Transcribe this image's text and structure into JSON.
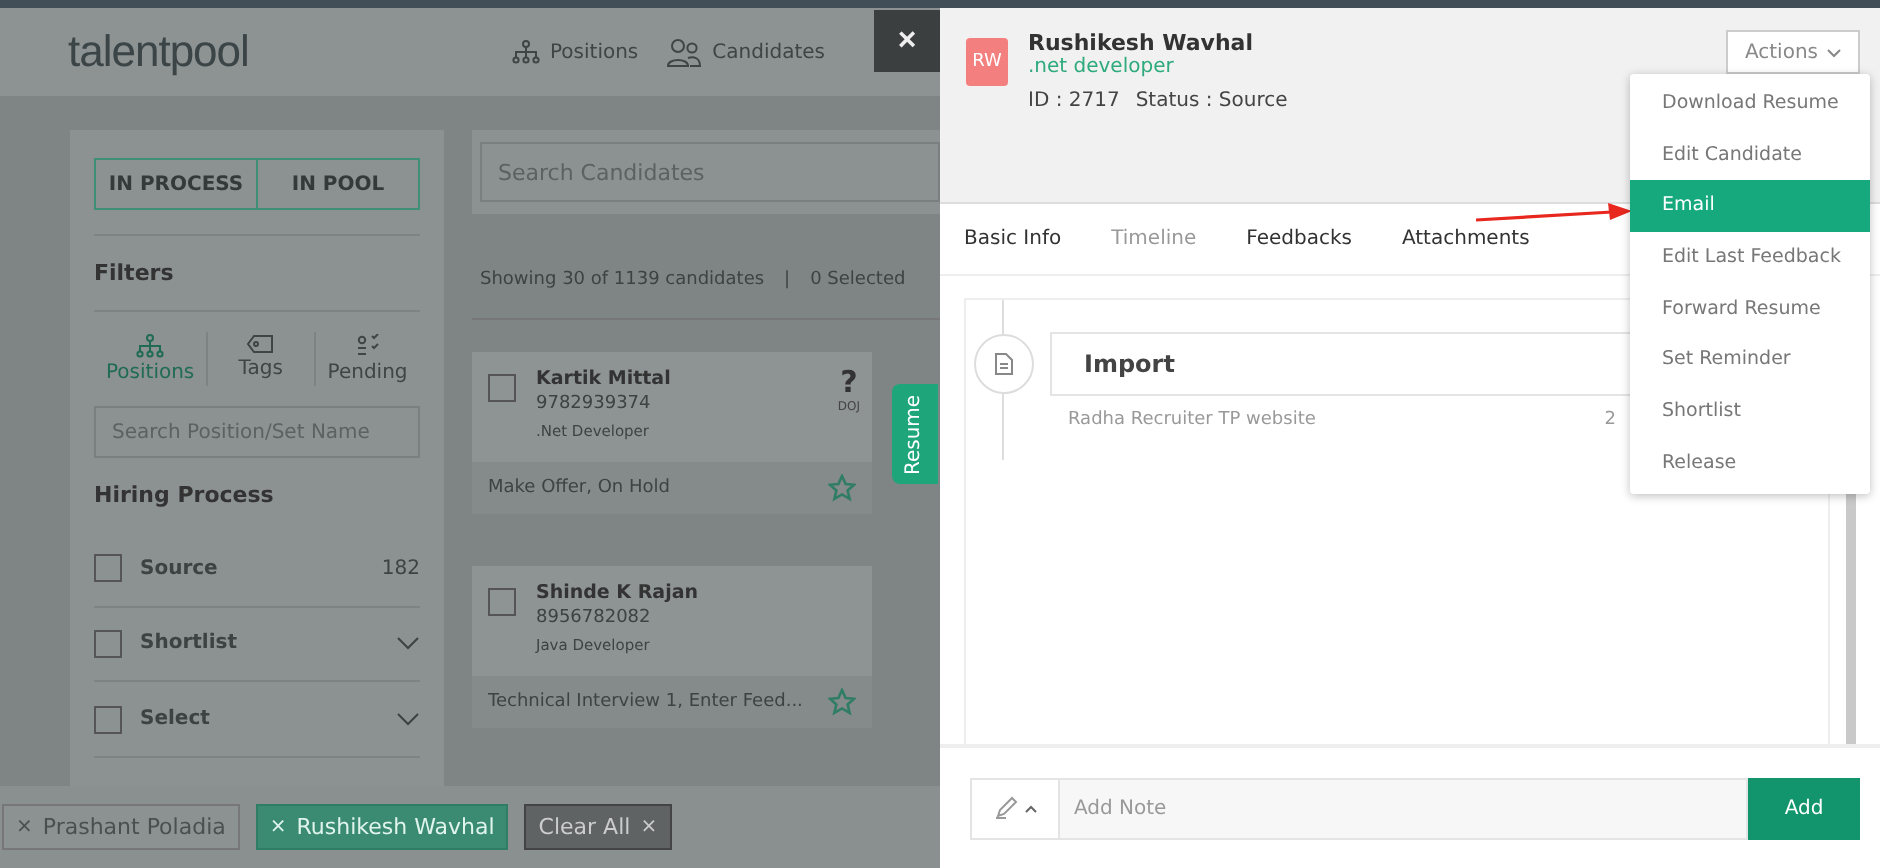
{
  "header": {
    "logo": "talentpool",
    "nav": [
      {
        "label": "Positions"
      },
      {
        "label": "Candidates"
      }
    ]
  },
  "close_button": "×",
  "sidebar": {
    "toggle": [
      "IN PROCESS",
      "IN POOL"
    ],
    "filters_title": "Filters",
    "filter_tabs": [
      {
        "label": "Positions",
        "selected": true
      },
      {
        "label": "Tags",
        "selected": false
      },
      {
        "label": "Pending",
        "selected": false
      }
    ],
    "position_search": {
      "placeholder": "Search Position/Set Name"
    },
    "hiring_title": "Hiring Process",
    "stages": [
      {
        "label": "Source",
        "count": "182",
        "checked": false
      },
      {
        "label": "Shortlist",
        "checked": false,
        "expandable": true
      },
      {
        "label": "Select",
        "checked": false,
        "expandable": true
      }
    ]
  },
  "list": {
    "search": {
      "placeholder": "Search Candidates"
    },
    "summary": "Showing 30 of 1139 candidates",
    "separator": "|",
    "selected_count": "0 Selected",
    "cards": [
      {
        "name": "Kartik Mittal",
        "phone": "9782939374",
        "role": ".Net Developer",
        "status": "Make Offer, On Hold",
        "doj": "?",
        "doj_label": "DOJ",
        "checked": false
      },
      {
        "name": "Shinde K Rajan",
        "phone": "8956782082",
        "role": "Java Developer",
        "status": "Technical Interview 1, Enter Feed...",
        "checked": false
      }
    ]
  },
  "resume_tab": "Resume",
  "chips": [
    {
      "label": "Prashant Poladia",
      "selected": false
    },
    {
      "label": "Rushikesh Wavhal",
      "selected": true
    }
  ],
  "clear_all": "Clear All",
  "chip_close": "×",
  "candidate": {
    "initials": "RW",
    "name": "Rushikesh Wavhal",
    "role": ".net developer",
    "id": "ID : 2717",
    "status": "Status : Source"
  },
  "actions": {
    "label": "Actions",
    "menu": [
      {
        "label": "Download Resume",
        "selected": false
      },
      {
        "label": "Edit Candidate",
        "selected": false
      },
      {
        "label": "Email",
        "selected": true
      },
      {
        "label": "Edit Last Feedback",
        "selected": false
      },
      {
        "label": "Forward Resume",
        "selected": false
      },
      {
        "label": "Set Reminder",
        "selected": false
      },
      {
        "label": "Shortlist",
        "selected": false
      },
      {
        "label": "Release",
        "selected": false
      }
    ]
  },
  "tabs": [
    {
      "label": "Basic Info",
      "selected": false
    },
    {
      "label": "Timeline",
      "selected": true
    },
    {
      "label": "Feedbacks",
      "selected": false
    },
    {
      "label": "Attachments",
      "selected": false
    }
  ],
  "timeline": [
    {
      "title": "Import",
      "by": "Radha Recruiter TP website",
      "date": "2"
    }
  ],
  "note": {
    "placeholder": "Add Note",
    "button": "Add"
  }
}
